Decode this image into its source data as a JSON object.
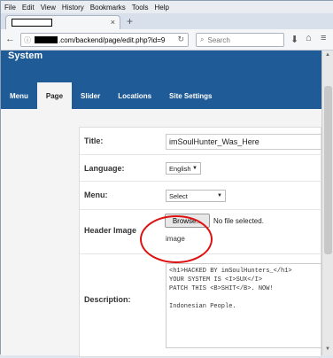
{
  "browser": {
    "menu": [
      "File",
      "Edit",
      "View",
      "History",
      "Bookmarks",
      "Tools",
      "Help"
    ],
    "tab_close": "×",
    "new_tab": "+",
    "url_suffix": ".com/backend/page/edit.php?id=9",
    "search_placeholder": "Search"
  },
  "site": {
    "title": "System",
    "nav": [
      "Menu",
      "Page",
      "Slider",
      "Locations",
      "Site Settings"
    ],
    "active_nav": "Page"
  },
  "form": {
    "title_label": "Title:",
    "title_value": "imSoulHunter_Was_Here",
    "language_label": "Language:",
    "language_value": "English",
    "menu_label": "Menu:",
    "menu_value": "Select",
    "header_image_label": "Header Image",
    "browse_label": "Browse...",
    "file_status": "No file selected.",
    "image_caption": "image",
    "description_label": "Description:",
    "description_value": "<h1>HACKED BY imSoulHunters_</h1>\nYOUR SYSTEM IS <I>SUX</I>\nPATCH THIS <B>SHIT</B>. NOW!\n\nIndonesian People."
  }
}
